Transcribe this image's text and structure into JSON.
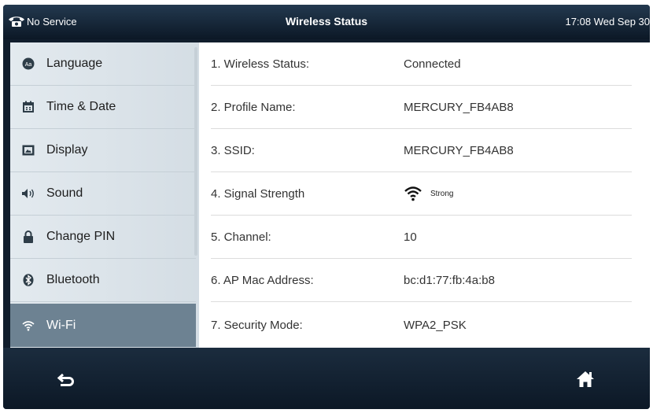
{
  "status_bar": {
    "service": "No Service",
    "title": "Wireless Status",
    "clock": "17:08 Wed Sep 30"
  },
  "sidebar": {
    "items": [
      {
        "label": "Language",
        "icon": "language-icon",
        "active": false
      },
      {
        "label": "Time & Date",
        "icon": "calendar-icon",
        "active": false
      },
      {
        "label": "Display",
        "icon": "display-icon",
        "active": false
      },
      {
        "label": "Sound",
        "icon": "speaker-icon",
        "active": false
      },
      {
        "label": "Change PIN",
        "icon": "lock-icon",
        "active": false
      },
      {
        "label": "Bluetooth",
        "icon": "bluetooth-icon",
        "active": false
      },
      {
        "label": "Wi-Fi",
        "icon": "wifi-icon",
        "active": true
      }
    ]
  },
  "status_rows": [
    {
      "label": "1. Wireless Status:",
      "value": "Connected"
    },
    {
      "label": "2. Profile Name:",
      "value": "MERCURY_FB4AB8"
    },
    {
      "label": "3. SSID:",
      "value": "MERCURY_FB4AB8"
    },
    {
      "label": "4. Signal Strength",
      "value": "Strong",
      "icon": "wifi-signal-icon"
    },
    {
      "label": "5. Channel:",
      "value": "10"
    },
    {
      "label": "6. AP Mac Address:",
      "value": "bc:d1:77:fb:4a:b8"
    },
    {
      "label": "7. Security Mode:",
      "value": "WPA2_PSK"
    }
  ],
  "softkeys": {
    "back": "back-arrow-icon",
    "home": "home-icon"
  },
  "colors": {
    "active_item": "#6d8292",
    "topbar": "#1b2c3e",
    "sidebar": "#e0e7ec"
  }
}
